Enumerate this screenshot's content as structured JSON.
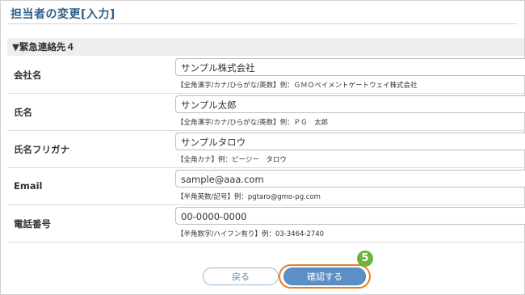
{
  "page": {
    "title": "担当者の変更[入力]"
  },
  "section": {
    "header": "▼緊急連絡先４"
  },
  "fields": [
    {
      "label": "会社名",
      "value": "サンプル株式会社",
      "hint": "【全角漢字/カナ/ひらがな/英数】例：ＧＭＯペイメントゲートウェイ株式会社"
    },
    {
      "label": "氏名",
      "value": "サンプル太郎",
      "hint": "【全角漢字/カナ/ひらがな/英数】例：ＰＧ　太郎"
    },
    {
      "label": "氏名フリガナ",
      "value": "サンプルタロウ",
      "hint": "【全角カナ】例：ピージー　タロウ"
    },
    {
      "label": "Email",
      "value": "sample@aaa.com",
      "hint": "【半角英数/記号】例：pgtaro@gmo-pg.com"
    },
    {
      "label": "電話番号",
      "value": "00-0000-0000",
      "hint": "【半角数字/ハイフン有り】例：03-3464-2740"
    }
  ],
  "buttons": {
    "back": "戻る",
    "confirm": "確認する"
  },
  "badge": {
    "number": "5",
    "color": "#6db33f"
  },
  "colors": {
    "accent": "#5b8fc6",
    "highlight_ring": "#f07d1a",
    "title": "#2f5f8a"
  }
}
